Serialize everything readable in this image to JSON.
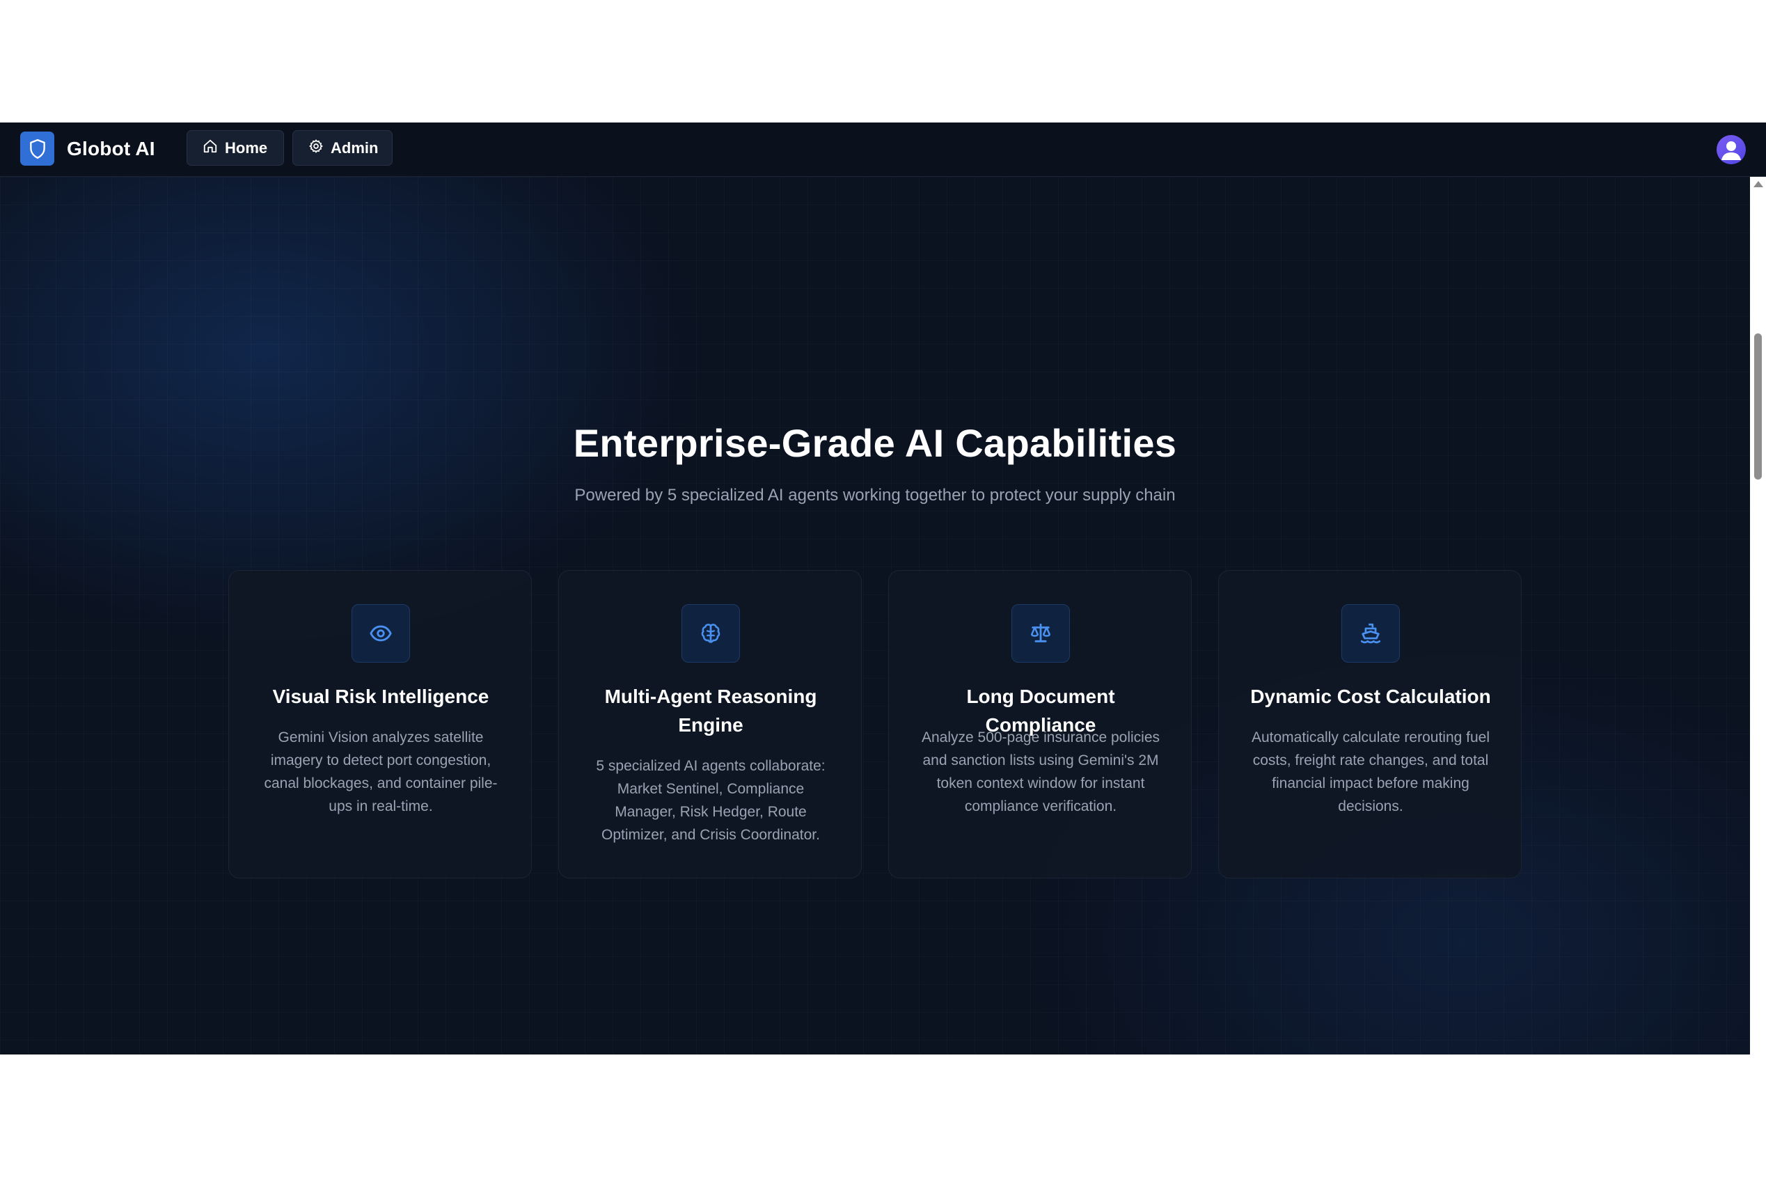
{
  "navbar": {
    "brand": "Globot AI",
    "logo_icon": "shield-icon",
    "home_label": "Home",
    "home_icon": "home-icon",
    "admin_label": "Admin",
    "admin_icon": "gear-icon",
    "avatar_icon": "user-avatar-icon"
  },
  "hero": {
    "title": "Enterprise-Grade AI Capabilities",
    "subtitle": "Powered by 5 specialized AI agents working together to protect your supply chain"
  },
  "features": [
    {
      "icon": "eye-icon",
      "title": "Visual Risk Intelligence",
      "description": "Gemini Vision analyzes satellite imagery to detect port congestion, canal blockages, and container pile-ups in real-time."
    },
    {
      "icon": "brain-icon",
      "title": "Multi-Agent Reasoning Engine",
      "description": "5 specialized AI agents collaborate: Market Sentinel, Compliance Manager, Risk Hedger, Route Optimizer, and Crisis Coordinator."
    },
    {
      "icon": "scale-icon",
      "title": "Long Document Compliance",
      "description": "Analyze 500-page insurance policies and sanction lists using Gemini's 2M token context window for instant compliance verification."
    },
    {
      "icon": "ship-icon",
      "title": "Dynamic Cost Calculation",
      "description": "Automatically calculate rerouting fuel costs, freight rate changes, and total financial impact before making decisions."
    }
  ],
  "colors": {
    "accent": "#2f6fd6",
    "icon_blue": "#4a90f0",
    "background": "#0b1220",
    "text_muted": "#9aa3b2"
  }
}
